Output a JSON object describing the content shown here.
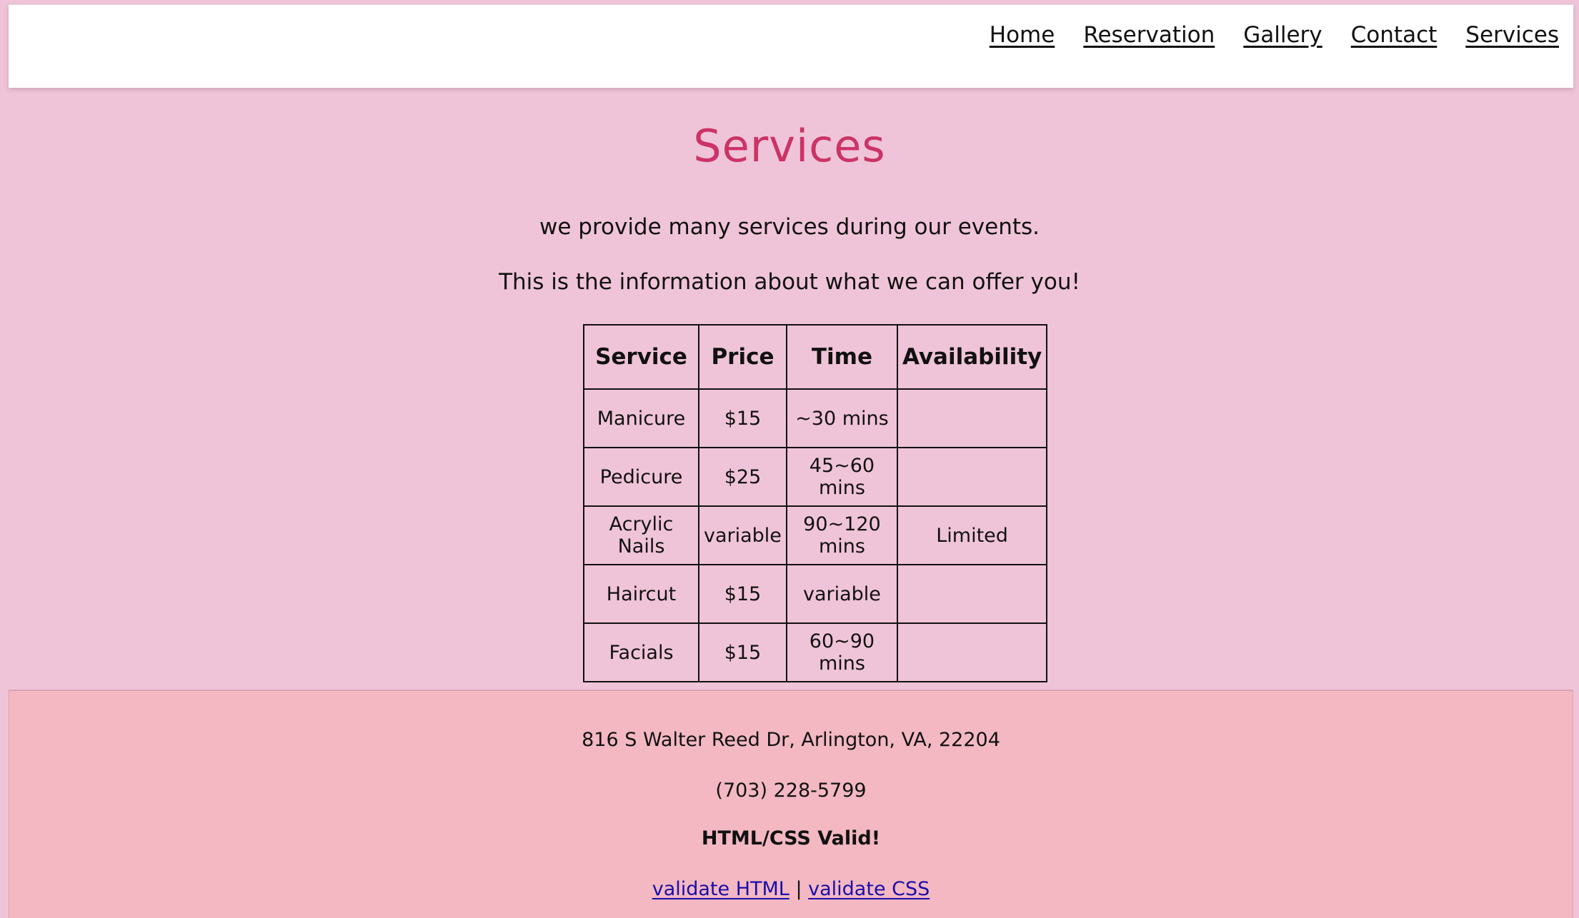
{
  "nav": {
    "items": [
      "Home",
      "Reservation",
      "Gallery",
      "Contact",
      "Services"
    ]
  },
  "main": {
    "title": "Services",
    "intro_line1": "we provide many services during our events.",
    "intro_line2": "This is the information about what we can offer you!"
  },
  "table": {
    "headers": [
      "Service",
      "Price",
      "Time",
      "Availability"
    ],
    "rows": [
      [
        "Manicure",
        "$15",
        "~30 mins",
        ""
      ],
      [
        "Pedicure",
        "$25",
        "45~60 mins",
        ""
      ],
      [
        "Acrylic Nails",
        "variable",
        "90~120 mins",
        "Limited"
      ],
      [
        "Haircut",
        "$15",
        "variable",
        ""
      ],
      [
        "Facials",
        "$15",
        "60~90 mins",
        ""
      ]
    ]
  },
  "footer": {
    "address": "816 S Walter Reed Dr, Arlington, VA, 22204",
    "phone": "(703) 228-5799",
    "valid_text": "HTML/CSS Valid!",
    "validate_html": "validate HTML",
    "separator": "|",
    "validate_css": "validate CSS"
  },
  "colors": {
    "page_bg": "#f0c4d8",
    "title": "#cc3366",
    "footer_bg": "#f3b8c2",
    "link": "#1a0dab"
  }
}
